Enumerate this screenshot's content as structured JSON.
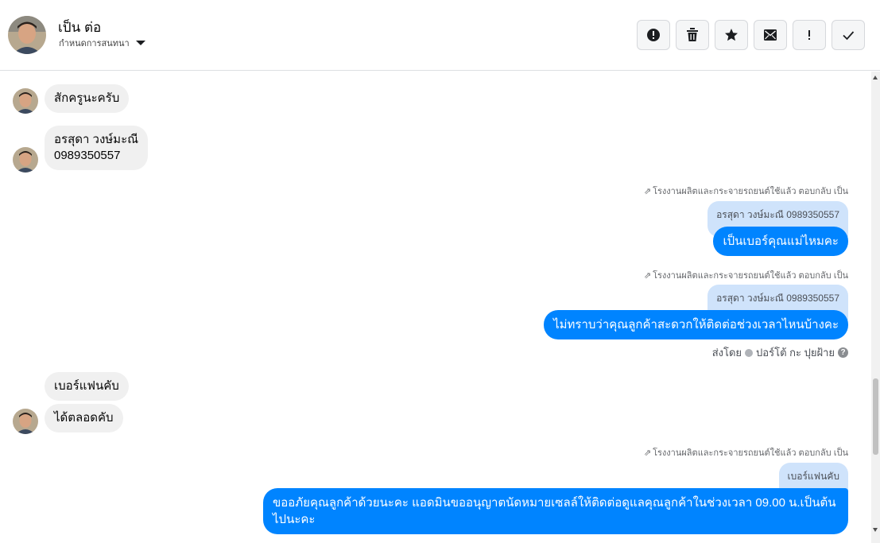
{
  "header": {
    "name": "เป็น ต่อ",
    "subtitle": "กำหนดการสนทนา",
    "actions": [
      {
        "icon": "alert-circle-icon"
      },
      {
        "icon": "trash-icon"
      },
      {
        "icon": "star-icon"
      },
      {
        "icon": "mark-unread-icon"
      },
      {
        "icon": "exclamation-icon"
      },
      {
        "icon": "check-icon"
      }
    ]
  },
  "messages": {
    "m1": "สักครูนะครับ",
    "m2_line1": "อรสุดา วงษ์มะณี",
    "m2_line2": "0989350557",
    "reply_note_1": "โรงงานผลิตและกระจายรถยนต์ใช้แล้ว ตอบกลับ เป็น",
    "quote_1": "อรสุดา วงษ์มะณี 0989350557",
    "out_1": "เป็นเบอร์คุณแม่ไหมคะ",
    "reply_note_2": "โรงงานผลิตและกระจายรถยนต์ใช้แล้ว ตอบกลับ เป็น",
    "quote_2": "อรสุดา วงษ์มะณี 0989350557",
    "out_2": "ไม่ทราบว่าคุณลูกค้าสะดวกให้ติดต่อช่วงเวลาไหนบ้างคะ",
    "sent_by_label": "ส่งโดย",
    "sent_by_name": "ปอร์โต้ กะ ปุยฝ้าย",
    "m3": "เบอร์แฟนคับ",
    "m4": "ได้ตลอดคับ",
    "reply_note_3": "โรงงานผลิตและกระจายรถยนต์ใช้แล้ว ตอบกลับ เป็น",
    "quote_3": "เบอร์แฟนคับ",
    "out_3_line1": "ขออภัยคุณลูกค้าด้วยนะคะ แอดมินขออนุญาตนัดหมายเซลล์ให้ติดต่อดูแลคุณลูกค้าในช่วงเวลา 09.00 น.เป็นต้น",
    "out_3_line2": "ไปนะคะ"
  },
  "colors": {
    "outgoing": "#0084ff",
    "incoming": "#f0f0f0",
    "quote": "#cfe3fb"
  }
}
